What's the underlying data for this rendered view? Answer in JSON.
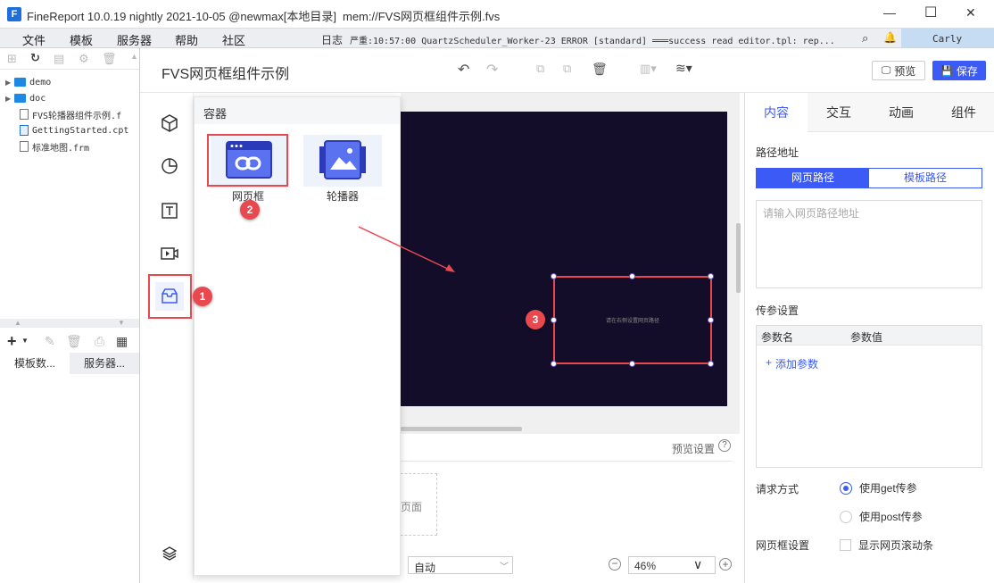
{
  "window": {
    "title": "FineReport 10.0.19 nightly 2021-10-05 @newmax[本地目录]",
    "file": "mem://FVS网页框组件示例.fvs",
    "minimize": "—",
    "maximize": "☐",
    "close": "✕"
  },
  "menu": [
    "文件",
    "模板",
    "服务器",
    "帮助",
    "社区"
  ],
  "log": {
    "prefix": "日志",
    "text": "严重:10:57:00 QuartzScheduler_Worker-23 ERROR [standard] ═══success read editor.tpl: rep...",
    "user": "Carly"
  },
  "tree": [
    {
      "label": "demo",
      "type": "folder"
    },
    {
      "label": "doc",
      "type": "folder"
    },
    {
      "label": "FVS轮播器组件示例.f",
      "type": "file"
    },
    {
      "label": "GettingStarted.cpt",
      "type": "cpt"
    },
    {
      "label": "标准地图.frm",
      "type": "file"
    }
  ],
  "left_tabs": [
    "模板数...",
    "服务器..."
  ],
  "doc_title": "FVS网页框组件示例",
  "toolbar": {
    "preview": "预览",
    "save": "保存"
  },
  "popup": {
    "header": "容器",
    "items": [
      "网页框",
      "轮播器"
    ]
  },
  "canvas": {
    "widget_placeholder": "请在右侧设置网页路径"
  },
  "bottom": {
    "preview_settings": "预览设置",
    "page_label": "页面",
    "auto": "自动",
    "zoom": "46%"
  },
  "right": {
    "tabs": [
      "内容",
      "交互",
      "动画",
      "组件"
    ],
    "path_label": "路径地址",
    "path_tabs": [
      "网页路径",
      "模板路径"
    ],
    "path_placeholder": "请输入网页路径地址",
    "param_label": "传参设置",
    "param_cols": [
      "参数名",
      "参数值"
    ],
    "add_param": "添加参数",
    "request_label": "请求方式",
    "req_opt1": "使用get传参",
    "req_opt2": "使用post传参",
    "frame_label": "网页框设置",
    "scroll_opt": "显示网页滚动条"
  },
  "badges": [
    "1",
    "2",
    "3"
  ],
  "colors": {
    "accent": "#3c5af5",
    "canvas_bg": "#130d2a",
    "annotation": "#e8484e"
  }
}
